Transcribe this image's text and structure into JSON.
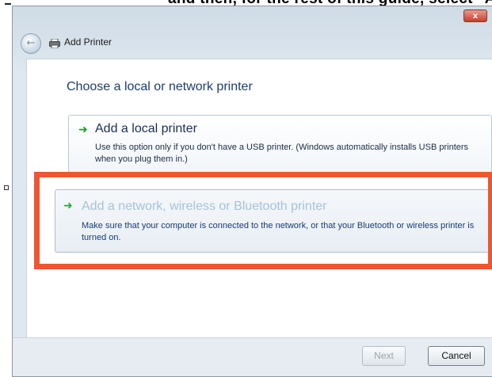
{
  "background_text": "and then, for the rest of this guide, select \"Add a network printer\"",
  "window": {
    "title": "Add Printer",
    "close_label": "x"
  },
  "heading": "Choose a local or network printer",
  "options": [
    {
      "title": "Add a local printer",
      "description": "Use this option only if you don't have a USB printer. (Windows automatically installs USB printers when you plug them in.)"
    },
    {
      "title": "Add a network, wireless or Bluetooth printer",
      "description": "Make sure that your computer is connected to the network, or that your Bluetooth or wireless printer is turned on."
    }
  ],
  "buttons": {
    "next": "Next",
    "cancel": "Cancel"
  },
  "colors": {
    "highlight": "#ee5630",
    "arrow": "#1e9a2c",
    "heading": "#1e3d6b"
  },
  "icons": [
    "back-arrow-icon",
    "printer-icon",
    "close-icon",
    "green-arrow-icon"
  ]
}
